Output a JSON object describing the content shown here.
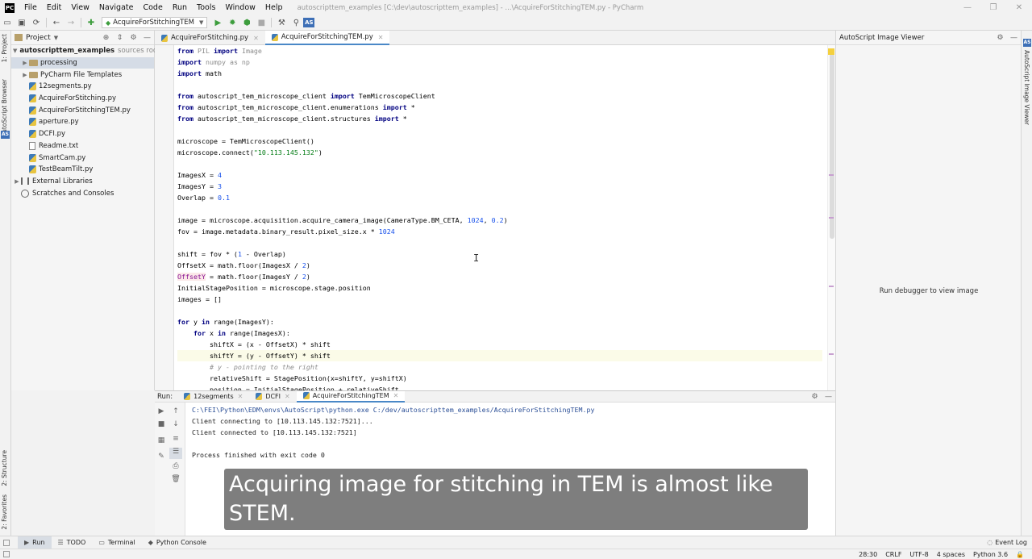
{
  "app": {
    "window_title": "autoscripttem_examples [C:\\dev\\autoscripttem_examples] - ...\\AcquireForStitchingTEM.py - PyCharm",
    "menu": [
      "File",
      "Edit",
      "View",
      "Navigate",
      "Code",
      "Run",
      "Tools",
      "Window",
      "Help"
    ]
  },
  "toolbar": {
    "run_config": "AcquireForStitchingTEM",
    "as_badge": "AS"
  },
  "left_strip": {
    "tabs": [
      "1: Project",
      "AutoScript Browser",
      "2: Structure",
      "2: Favorites"
    ],
    "as_badge": "AS"
  },
  "project": {
    "title": "Project",
    "root": {
      "name": "autoscripttem_examples",
      "hint": "sources root"
    },
    "items": [
      {
        "label": "processing",
        "type": "folder",
        "level": 1,
        "arrow": "▶",
        "selected": true
      },
      {
        "label": "PyCharm File Templates",
        "type": "folder",
        "level": 1,
        "arrow": "▶"
      },
      {
        "label": "12segments.py",
        "type": "py",
        "level": 1
      },
      {
        "label": "AcquireForStitching.py",
        "type": "py",
        "level": 1
      },
      {
        "label": "AcquireForStitchingTEM.py",
        "type": "py",
        "level": 1
      },
      {
        "label": "aperture.py",
        "type": "py",
        "level": 1
      },
      {
        "label": "DCFI.py",
        "type": "py",
        "level": 1
      },
      {
        "label": "Readme.txt",
        "type": "txt",
        "level": 1
      },
      {
        "label": "SmartCam.py",
        "type": "py",
        "level": 1
      },
      {
        "label": "TestBeamTilt.py",
        "type": "py",
        "level": 1
      }
    ],
    "external": "External Libraries",
    "scratches": "Scratches and Consoles"
  },
  "editor_tabs": [
    {
      "label": "AcquireForStitching.py",
      "active": false
    },
    {
      "label": "AcquireForStitchingTEM.py",
      "active": true
    }
  ],
  "code_lines": [
    "from PIL import Image",
    "import numpy as np",
    "import math",
    "",
    "from autoscript_tem_microscope_client import TemMicroscopeClient",
    "from autoscript_tem_microscope_client.enumerations import *",
    "from autoscript_tem_microscope_client.structures import *",
    "",
    "microscope = TemMicroscopeClient()",
    "microscope.connect(\"10.113.145.132\")",
    "",
    "ImagesX = 4",
    "ImagesY = 3",
    "Overlap = 0.1",
    "",
    "image = microscope.acquisition.acquire_camera_image(CameraType.BM_CETA, 1024, 0.2)",
    "fov = image.metadata.binary_result.pixel_size.x * 1024",
    "",
    "shift = fov * (1 - Overlap)",
    "OffsetX = math.floor(ImagesX / 2)",
    "OffsetY = math.floor(ImagesY / 2)",
    "InitialStagePosition = microscope.stage.position",
    "images = []",
    "",
    "for y in range(ImagesY):",
    "    for x in range(ImagesX):",
    "        shiftX = (x - OffsetX) * shift",
    "        shiftY = (y - OffsetY) * shift",
    "        # y - pointing to the right",
    "        relativeShift = StagePosition(x=shiftY, y=shiftX)",
    "        position = InitialStagePosition + relativeShift"
  ],
  "viewer": {
    "title": "AutoScript Image Viewer",
    "message": "Run debugger to view image",
    "strip_label": "AutoScript Image Viewer",
    "as_badge": "AS"
  },
  "run": {
    "label": "Run:",
    "tabs": [
      {
        "label": "12segments",
        "active": false
      },
      {
        "label": "DCFI",
        "active": false
      },
      {
        "label": "AcquireForStitchingTEM",
        "active": true
      }
    ],
    "console": [
      "C:\\FEI\\Python\\EDM\\envs\\AutoScript\\python.exe C:/dev/autoscripttem_examples/AcquireForStitchingTEM.py",
      "Client connecting to [10.113.145.132:7521]...",
      "Client connected to [10.113.145.132:7521]",
      "",
      "Process finished with exit code 0"
    ]
  },
  "subtitle": "Acquiring image for stitching in TEM is almost like STEM.",
  "bottom_bar": {
    "tabs": [
      "Run",
      "TODO",
      "Terminal",
      "Python Console"
    ],
    "event_log": "Event Log"
  },
  "status": {
    "position": "28:30",
    "line_sep": "CRLF",
    "encoding": "UTF-8",
    "indent": "4 spaces",
    "interpreter": "Python 3.6"
  }
}
